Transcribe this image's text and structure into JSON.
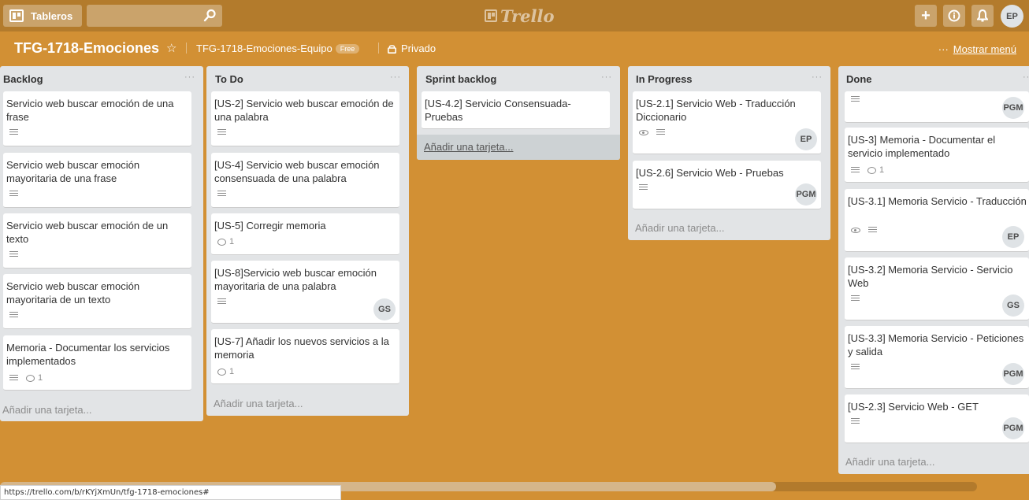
{
  "topbar": {
    "boards_label": "Tableros",
    "search_placeholder": "",
    "logo_text": "Trello",
    "add_icon": "+",
    "info_icon": "i",
    "bell_icon": "bell",
    "user_initials": "EP",
    "accent_color": "#b37b2c"
  },
  "board": {
    "title": "TFG-1718-Emociones",
    "star_icon": "☆",
    "team": "TFG-1718-Emociones-Equipo",
    "team_badge": "Free",
    "privacy": "Privado",
    "menu_dots": "···",
    "show_menu": "Mostrar menú",
    "background_color": "#d29034"
  },
  "lists": [
    {
      "title": "Backlog",
      "menu": "···",
      "add_card": "Añadir una tarjeta...",
      "cards": [
        {
          "title": "Servicio web buscar emoción de una frase",
          "description": true
        },
        {
          "title": "Servicio web buscar emoción mayoritaria de una frase",
          "description": true
        },
        {
          "title": "Servicio web buscar emoción de un texto",
          "description": true
        },
        {
          "title": "Servicio web buscar emoción mayoritaria de un texto",
          "description": true
        },
        {
          "title": "Memoria - Documentar los servicios implementados",
          "description": true,
          "comments": "1"
        }
      ]
    },
    {
      "title": "To Do",
      "menu": "···",
      "add_card": "Añadir una tarjeta...",
      "cards": [
        {
          "title": "[US-2] Servicio web buscar emoción de una palabra",
          "description": true
        },
        {
          "title": "[US-4] Servicio web buscar emoción consensuada de una palabra",
          "description": true
        },
        {
          "title": "[US-5] Corregir memoria",
          "comments": "1"
        },
        {
          "title": "[US-8]Servicio web buscar emoción mayoritaria de una palabra",
          "description": true,
          "member": "GS"
        },
        {
          "title": "[US-7] Añadir los nuevos servicios a la memoria",
          "comments": "1"
        }
      ]
    },
    {
      "title": "Sprint backlog",
      "menu": "···",
      "add_card": "Añadir una tarjeta...",
      "cards": [
        {
          "title": "[US-4.2] Servicio Consensuada-Pruebas"
        }
      ]
    },
    {
      "title": "In Progress",
      "menu": "···",
      "add_card": "Añadir una tarjeta...",
      "cards": [
        {
          "title": "[US-2.1] Servicio Web - Traducción Diccionario",
          "watching": true,
          "description": true,
          "member": "EP"
        },
        {
          "title": "[US-2.6] Servicio Web - Pruebas",
          "description": true,
          "member": "PGM"
        }
      ]
    },
    {
      "title": "Done",
      "menu": "···",
      "add_card": "Añadir una tarjeta...",
      "cards": [
        {
          "title": "",
          "description": true,
          "member": "PGM"
        },
        {
          "title": "[US-3] Memoria - Documentar el servicio implementado",
          "description": true,
          "comments": "1"
        },
        {
          "title": "[US-3.1] Memoria Servicio - Traducción",
          "watching": true,
          "description": true,
          "member": "EP"
        },
        {
          "title": "[US-3.2] Memoria Servicio - Servicio Web",
          "description": true,
          "member": "GS"
        },
        {
          "title": "[US-3.3] Memoria Servicio - Peticiones y salida",
          "description": true,
          "member": "PGM"
        },
        {
          "title": "[US-2.3] Servicio Web - GET",
          "description": true,
          "member": "PGM"
        }
      ]
    }
  ],
  "status_url": "https://trello.com/b/rKYjXmUn/tfg-1718-emociones#"
}
